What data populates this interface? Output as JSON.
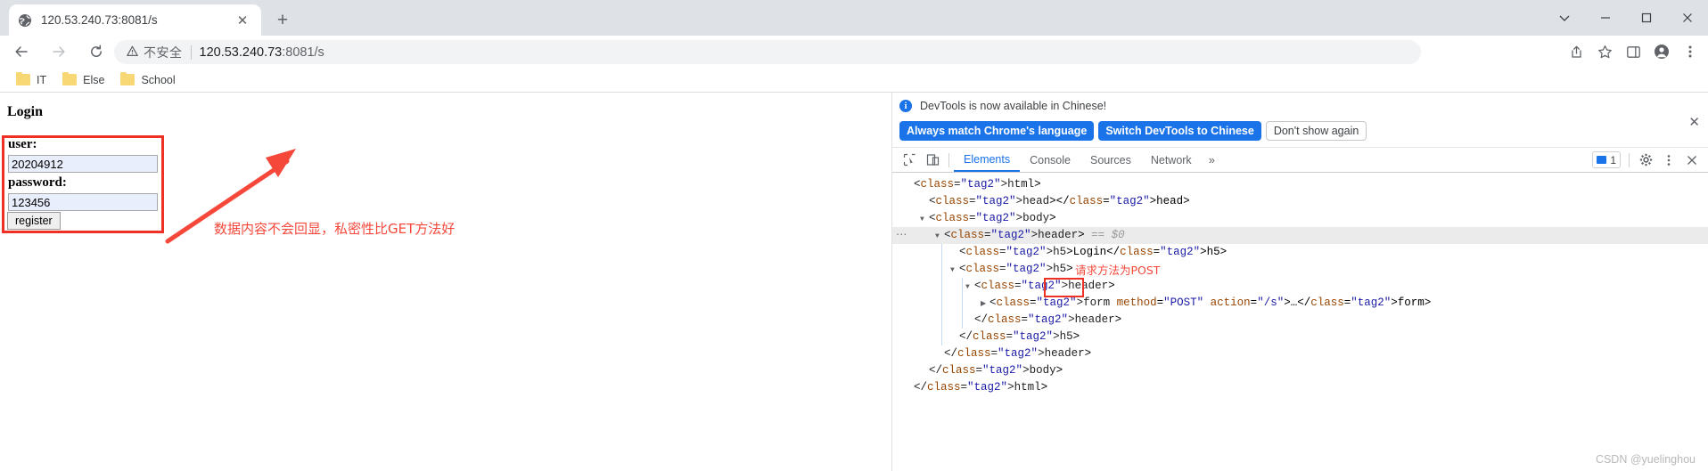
{
  "browser": {
    "tab": {
      "title": "120.53.240.73:8081/s",
      "favicon": "globe-icon",
      "close": "✕"
    },
    "newtab_label": "+",
    "window_controls": {
      "minimize": "─",
      "maximize": "□",
      "close": "✕",
      "chevron": "⌄"
    },
    "nav": {
      "back": "←",
      "forward": "→",
      "reload": "⟳"
    },
    "omnibox": {
      "warning_icon": "warning-triangle-icon",
      "security_text": "不安全",
      "url_host": "120.53.240.73",
      "url_rest": ":8081/s"
    },
    "toolbar_icons": [
      "share-icon",
      "star-icon",
      "sidepanel-icon",
      "profile-icon",
      "menu-icon"
    ],
    "bookmarks": [
      {
        "label": "IT",
        "icon": "folder-icon"
      },
      {
        "label": "Else",
        "icon": "folder-icon"
      },
      {
        "label": "School",
        "icon": "folder-icon"
      }
    ]
  },
  "page": {
    "heading": "Login",
    "fields": [
      {
        "label": "user:",
        "value": "20204912"
      },
      {
        "label": "password:",
        "value": "123456"
      }
    ],
    "register_button": "register",
    "annotation": "数据内容不会回显，私密性比GET方法好"
  },
  "devtools": {
    "notice": {
      "icon": "info-icon",
      "text": "DevTools is now available in Chinese!",
      "primary_button": "Always match Chrome's language",
      "secondary_button": "Switch DevTools to Chinese",
      "dismiss_button": "Don't show again",
      "close": "✕"
    },
    "tools": {
      "inspect": "inspect-element-icon",
      "device": "device-toolbar-icon"
    },
    "tabs": [
      {
        "label": "Elements",
        "active": true
      },
      {
        "label": "Console",
        "active": false
      },
      {
        "label": "Sources",
        "active": false
      },
      {
        "label": "Network",
        "active": false
      }
    ],
    "more_tabs": "»",
    "message_count": "1",
    "settings_icon": "gear-icon",
    "kebab_icon": "more-vertical-icon",
    "close_icon": "close-icon",
    "dom_lines": [
      {
        "indent": 0,
        "tri": "",
        "html": "&lt;html&gt;",
        "selected": false
      },
      {
        "indent": 1,
        "tri": "",
        "html": "&lt;head&gt;&lt;/head&gt;",
        "selected": false
      },
      {
        "indent": 1,
        "tri": "▼",
        "html": "&lt;body&gt;",
        "selected": false
      },
      {
        "indent": 2,
        "tri": "▼",
        "html": "&lt;header&gt; == $0",
        "selected": true
      },
      {
        "indent": 3,
        "tri": "",
        "html": "&lt;h5&gt;Login&lt;/h5&gt;",
        "selected": false
      },
      {
        "indent": 3,
        "tri": "▼",
        "html": "&lt;h5&gt;",
        "selected": false
      },
      {
        "indent": 4,
        "tri": "▼",
        "html": "&lt;header&gt;",
        "selected": false
      },
      {
        "indent": 5,
        "tri": "▶",
        "html": "&lt;form method=\"POST\" action=\"/s\"&gt;…&lt;/form&gt;",
        "selected": false
      },
      {
        "indent": 4,
        "tri": "",
        "html": "&lt;/header&gt;",
        "selected": false
      },
      {
        "indent": 3,
        "tri": "",
        "html": "&lt;/h5&gt;",
        "selected": false
      },
      {
        "indent": 2,
        "tri": "",
        "html": "&lt;/header&gt;",
        "selected": false
      },
      {
        "indent": 1,
        "tri": "",
        "html": "&lt;/body&gt;",
        "selected": false
      },
      {
        "indent": 0,
        "tri": "",
        "html": "&lt;/html&gt;",
        "selected": false
      }
    ],
    "dom_annotation": "请求方法为POST",
    "ellipsis_marker": "⋯"
  },
  "watermark": "CSDN @yuelinghou",
  "colors": {
    "accent_blue": "#1a73e8",
    "annotation_red": "#f5483b",
    "box_red": "#ee3124",
    "tabstrip_bg": "#dee1e6",
    "omnibox_bg": "#f1f3f4",
    "input_bg": "#e8eefc"
  }
}
